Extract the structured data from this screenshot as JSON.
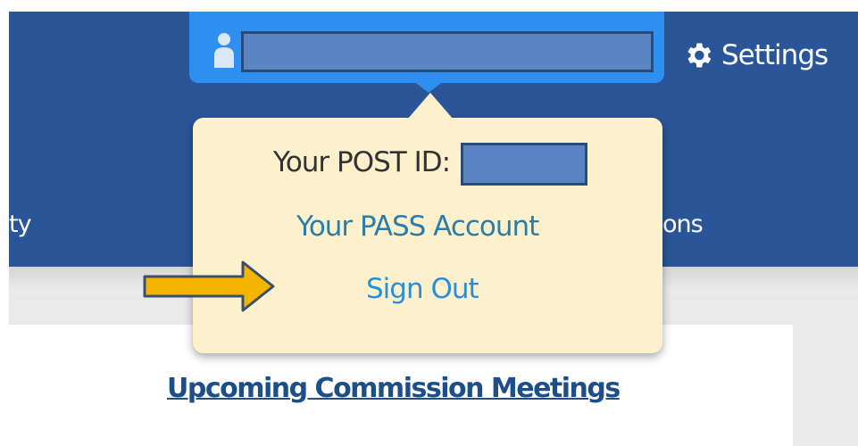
{
  "header": {
    "settings_label": "Settings",
    "nav_left_fragment": "ty",
    "nav_right_fragment": "ons"
  },
  "account_popup": {
    "post_id_label": "Your POST ID:",
    "pass_account_link": "Your PASS Account",
    "sign_out_link": "Sign Out"
  },
  "main": {
    "upcoming_meetings_title": "Upcoming Commission Meetings"
  },
  "colors": {
    "header_bg": "#2a5598",
    "user_bar": "#2f8ff0",
    "popup_bg": "#fdf0cd",
    "redaction": "#5b84c2",
    "arrow": "#f5b400"
  },
  "icons": {
    "user": "user-icon",
    "settings": "gear-icon",
    "pointer": "arrow-right-icon"
  }
}
